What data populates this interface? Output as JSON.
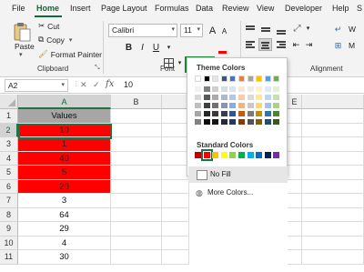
{
  "menu": {
    "tabs": [
      "File",
      "Home",
      "Insert",
      "Page Layout",
      "Formulas",
      "Data",
      "Review",
      "View",
      "Developer",
      "Help",
      "S"
    ],
    "active": "Home"
  },
  "ribbon": {
    "clipboard": {
      "paste_label": "Paste",
      "cut_label": "Cut",
      "copy_label": "Copy",
      "format_painter_label": "Format Painter",
      "group_label": "Clipboard"
    },
    "font": {
      "font_name": "Calibri",
      "font_size": "11",
      "bold_glyph": "B",
      "italic_glyph": "I",
      "underline_glyph": "U",
      "font_color_glyph": "A",
      "grow_glyph": "A",
      "shrink_glyph": "A",
      "group_label": "Font"
    },
    "alignment": {
      "wrap_label": "W",
      "merge_label": "M",
      "group_label": "Alignment"
    }
  },
  "formula_bar": {
    "name_box": "A2",
    "cancel_glyph": "✕",
    "enter_glyph": "✓",
    "fx_glyph": "fx",
    "value": "10"
  },
  "grid": {
    "columns": [
      "A",
      "B",
      "E"
    ],
    "rows": [
      "1",
      "2",
      "3",
      "4",
      "5",
      "6",
      "7",
      "8",
      "9",
      "10",
      "11"
    ],
    "a_values": [
      "Values",
      "10",
      "1",
      "40",
      "5",
      "20",
      "3",
      "64",
      "29",
      "4",
      "30"
    ]
  },
  "color_menu": {
    "theme_heading": "Theme Colors",
    "standard_heading": "Standard Colors",
    "no_fill_label": "No Fill",
    "more_colors_label": "More Colors...",
    "selected_standard": "Red",
    "theme_top": [
      "#ffffff",
      "#000000",
      "#e7e6e6",
      "#44546a",
      "#4472c4",
      "#ed7d31",
      "#a5a5a5",
      "#ffc000",
      "#5b9bd5",
      "#70ad47"
    ],
    "standard_colors": [
      "#c00000",
      "#ff0000",
      "#ffc000",
      "#ffff00",
      "#92d050",
      "#00b050",
      "#00b0f0",
      "#0070c0",
      "#002060",
      "#7030a0"
    ]
  },
  "colors": {
    "accent_green": "#1e7145",
    "header_fill": "#a6a6a6",
    "highlight_red": "#ff0000"
  }
}
